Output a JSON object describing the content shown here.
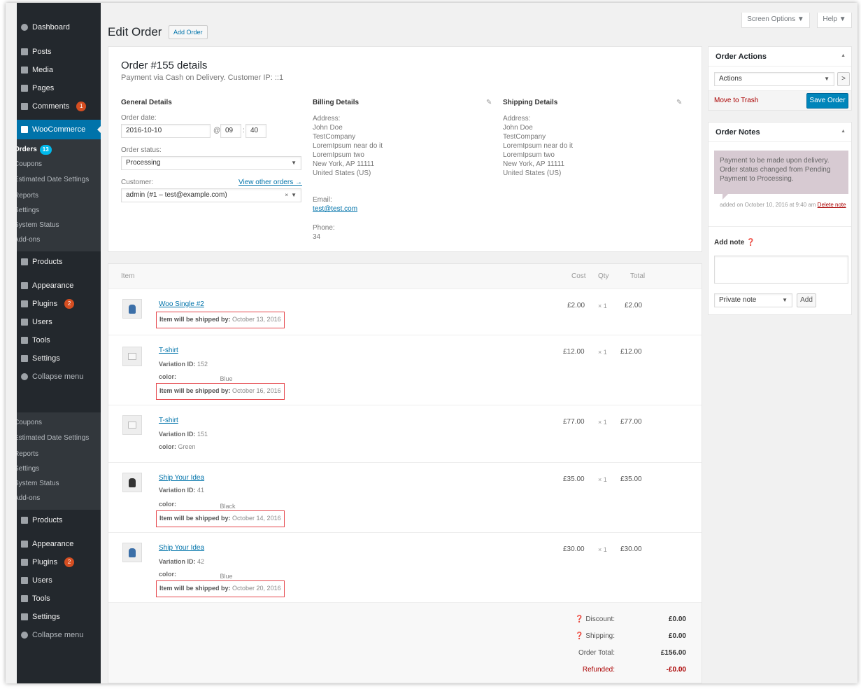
{
  "sidebar": {
    "top": [
      {
        "label": "Dashboard"
      },
      {
        "label": "Posts"
      },
      {
        "label": "Media"
      },
      {
        "label": "Pages"
      },
      {
        "label": "Comments",
        "badge": "1"
      }
    ],
    "woocommerce": "WooCommerce",
    "submenu1": [
      {
        "label": "Orders",
        "badge": "13"
      },
      {
        "label": "Coupons"
      },
      {
        "label": "Estimated Date Settings"
      },
      {
        "label": "Reports"
      },
      {
        "label": "Settings"
      },
      {
        "label": "System Status"
      },
      {
        "label": "Add-ons"
      }
    ],
    "middle1": [
      {
        "label": "Products"
      },
      {
        "label": "Appearance"
      },
      {
        "label": "Plugins",
        "badge": "2"
      },
      {
        "label": "Users"
      },
      {
        "label": "Tools"
      },
      {
        "label": "Settings"
      },
      {
        "label": "Collapse menu"
      }
    ],
    "submenu2": [
      {
        "label": "Coupons"
      },
      {
        "label": "Estimated Date Settings"
      },
      {
        "label": "Reports"
      },
      {
        "label": "Settings"
      },
      {
        "label": "System Status"
      },
      {
        "label": "Add-ons"
      }
    ],
    "middle2": [
      {
        "label": "Products"
      },
      {
        "label": "Appearance"
      },
      {
        "label": "Plugins",
        "badge": "2"
      },
      {
        "label": "Users"
      },
      {
        "label": "Tools"
      },
      {
        "label": "Settings"
      },
      {
        "label": "Collapse menu"
      }
    ]
  },
  "header": {
    "title": "Edit Order",
    "add_order": "Add Order",
    "screen_options": "Screen Options ▼",
    "help": "Help ▼"
  },
  "order": {
    "title": "Order #155 details",
    "subtitle": "Payment via Cash on Delivery. Customer IP: ::1",
    "general_heading": "General Details",
    "billing_heading": "Billing Details",
    "shipping_heading": "Shipping Details",
    "order_date_label": "Order date:",
    "order_date": "2016-10-10",
    "at": "@",
    "hour": "09",
    "colon": ":",
    "minute": "40",
    "status_label": "Order status:",
    "status": "Processing",
    "customer_label": "Customer:",
    "view_other_orders": "View other orders →",
    "customer": "admin (#1 – test@example.com)",
    "customer_clear": "×",
    "billing": {
      "address_label": "Address:",
      "lines": [
        "John Doe",
        "TestCompany",
        "LoremIpsum near do it",
        "LoremIpsum two",
        "New York, AP 11111",
        "United States (US)"
      ],
      "email_label": "Email:",
      "email": "test@test.com",
      "phone_label": "Phone:",
      "phone": "34"
    },
    "shipping": {
      "address_label": "Address:",
      "lines": [
        "John Doe",
        "TestCompany",
        "LoremIpsum near do it",
        "LoremIpsum two",
        "New York, AP 11111",
        "United States (US)"
      ]
    }
  },
  "items": {
    "headers": {
      "item": "Item",
      "cost": "Cost",
      "qty": "Qty",
      "total": "Total"
    },
    "ship_label": "Item will be shipped by:",
    "variation_label": "Variation ID:",
    "color_label": "color:",
    "rows": [
      {
        "name": "Woo Single #2",
        "cost": "£2.00",
        "qty": "× 1",
        "total": "£2.00",
        "ship_date": "October 13, 2016"
      },
      {
        "name": "T-shirt",
        "variation": "152",
        "color": "Blue",
        "cost": "£12.00",
        "qty": "× 1",
        "total": "£12.00",
        "ship_date": "October 16, 2016"
      },
      {
        "name": "T-shirt",
        "variation": "151",
        "color": "Green",
        "cost": "£77.00",
        "qty": "× 1",
        "total": "£77.00"
      },
      {
        "name": "Ship Your Idea",
        "variation": "41",
        "color": "Black",
        "cost": "£35.00",
        "qty": "× 1",
        "total": "£35.00",
        "ship_date": "October 14, 2016"
      },
      {
        "name": "Ship Your Idea",
        "variation": "42",
        "color": "Blue",
        "cost": "£30.00",
        "qty": "× 1",
        "total": "£30.00",
        "ship_date": "October 20, 2016"
      }
    ],
    "totals": {
      "discount_label": "Discount:",
      "discount": "£0.00",
      "shipping_label": "Shipping:",
      "shipping": "£0.00",
      "total_label": "Order Total:",
      "total": "£156.00",
      "refunded_label": "Refunded:",
      "refunded": "-£0.00"
    }
  },
  "actions": {
    "title": "Order Actions",
    "select": "Actions",
    "go": ">",
    "trash": "Move to Trash",
    "save": "Save Order"
  },
  "notes": {
    "title": "Order Notes",
    "note_text": "Payment to be made upon delivery. Order status changed from Pending Payment to Processing.",
    "note_meta": "added on October 10, 2016 at 9:40 am",
    "delete_note": "Delete note",
    "add_note_label": "Add note",
    "note_type": "Private note",
    "add_button": "Add"
  },
  "colors": {
    "sidebar": "#23282d",
    "accent": "#0073aa",
    "highlight_box": "#e5484d",
    "note_bg": "#d7cad2"
  }
}
